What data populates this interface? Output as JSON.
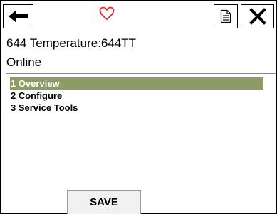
{
  "toolbar": {
    "back_icon": "arrow-left-icon",
    "favorite_icon": "heart-outline-icon",
    "favorite_color": "#e0282e",
    "document_icon": "document-icon",
    "close_icon": "close-x-icon"
  },
  "header": {
    "title": "644 Temperature:644TT",
    "status": "Online"
  },
  "menu": {
    "items": [
      {
        "label": "1 Overview",
        "selected": true
      },
      {
        "label": "2 Configure",
        "selected": false
      },
      {
        "label": "3 Service Tools",
        "selected": false
      }
    ],
    "selected_color": "#8d9c67"
  },
  "footer": {
    "save_label": "SAVE"
  }
}
